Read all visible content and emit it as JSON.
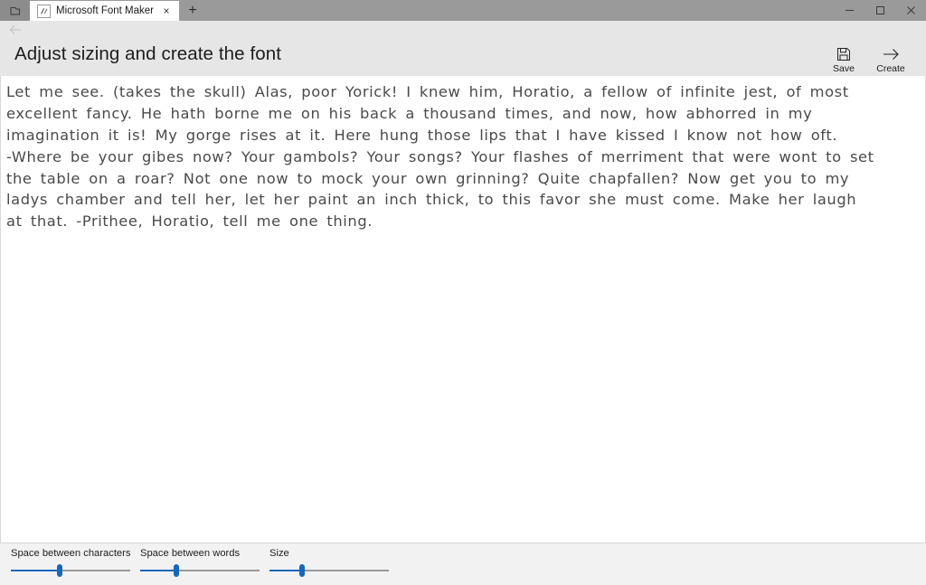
{
  "window": {
    "shell_icon": "tab-stack-icon",
    "minimize_label": "Minimize",
    "maximize_label": "Maximize",
    "close_label": "Close"
  },
  "tabs": [
    {
      "title": "Microsoft Font Maker",
      "favicon": "font-maker-icon",
      "close_label": "×",
      "active": true
    }
  ],
  "new_tab": {
    "label": "+"
  },
  "navbar": {
    "back_label": "←",
    "back_enabled": false
  },
  "header": {
    "title": "Adjust sizing and create the font",
    "actions": [
      {
        "label": "Save",
        "icon": "save-floppy-icon"
      },
      {
        "label": "Create",
        "icon": "arrow-right-icon"
      }
    ]
  },
  "preview": {
    "lines": [
      "Let me see. (takes the skull) Alas, poor Yorick! I knew him, Horatio, a fellow of infinite jest, of most",
      "excellent fancy. He hath borne me on his back a thousand times, and now, how abhorred in my",
      "imagination it is! My gorge rises at it. Here hung those lips that I have kissed I know not how oft.",
      "-Where be your gibes now? Your gambols? Your songs? Your flashes of merriment that were wont to set",
      "the table on a roar? Not one now to mock your own grinning? Quite chapfallen? Now get you to my",
      "ladys chamber and tell her, let her paint an inch thick, to this favor she must come. Make her laugh",
      "at that. -Prithee, Horatio, tell me one thing."
    ]
  },
  "sliders": [
    {
      "label": "Space between characters",
      "value": 41
    },
    {
      "label": "Space between words",
      "value": 30
    },
    {
      "label": "Size",
      "value": 27
    }
  ],
  "colors": {
    "accent": "#1668b8",
    "titlebar": "#9a9a9a",
    "header_bg": "#e6e6e6",
    "panel_bg": "#f2f2f2",
    "ink": "#4a4a4a"
  }
}
